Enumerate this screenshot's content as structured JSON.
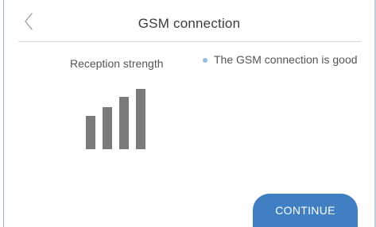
{
  "header": {
    "title": "GSM connection",
    "back_icon": "chevron-left-icon"
  },
  "reception": {
    "label": "Reception strength",
    "bars_total": 4,
    "bars_filled": 4,
    "bar_color": "#7b7b7b"
  },
  "status": {
    "text": "The GSM connection is good",
    "dot_color": "#8fbfe3"
  },
  "actions": {
    "continue_label": "CONTINUE",
    "continue_color": "#3f7fc2"
  }
}
